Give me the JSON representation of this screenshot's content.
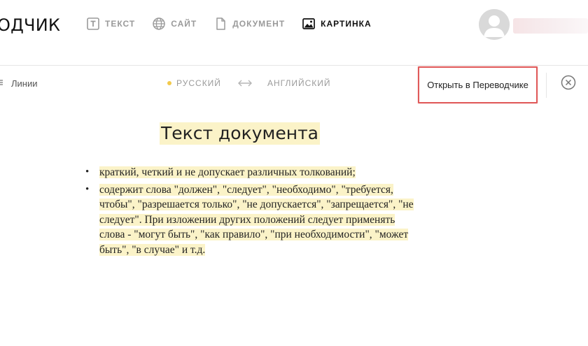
{
  "header": {
    "brand": "ОДЧИК",
    "nav": [
      {
        "label": "ТЕКСТ",
        "icon": "text-icon",
        "active": false
      },
      {
        "label": "САЙТ",
        "icon": "globe-icon",
        "active": false
      },
      {
        "label": "ДОКУМЕНТ",
        "icon": "document-icon",
        "active": false
      },
      {
        "label": "КАРТИНКА",
        "icon": "image-icon",
        "active": true
      }
    ],
    "avatar_icon": "user-avatar-icon"
  },
  "toolbar": {
    "lines_label": "Линии",
    "source_language": "РУССКИЙ",
    "target_language": "АНГЛИЙСКИЙ",
    "swap_icon": "swap-arrows-icon",
    "open_button_label": "Открыть в Переводчике",
    "close_icon": "close-circle-icon"
  },
  "document": {
    "title": "Текст документа",
    "items": [
      "краткий, четкий и не допускает различных толкований;",
      " содержит слова \"должен\", \"следует\", \"необходимо\", \"требуется, чтобы\", \"разрешается только\", \"не допускается\", \"запрещается\", \"не следует\". При изложении других положений следует применять слова - \"могут быть\", \"как правило\", \"при необходимости\", \"может быть\", \"в случае\" и т.д."
    ]
  },
  "colors": {
    "highlight": "#fbf3c8",
    "source_dot": "#f2c94c",
    "annotation_frame": "#e05a5a",
    "nav_inactive": "#9a9a9a",
    "nav_active": "#111111"
  }
}
